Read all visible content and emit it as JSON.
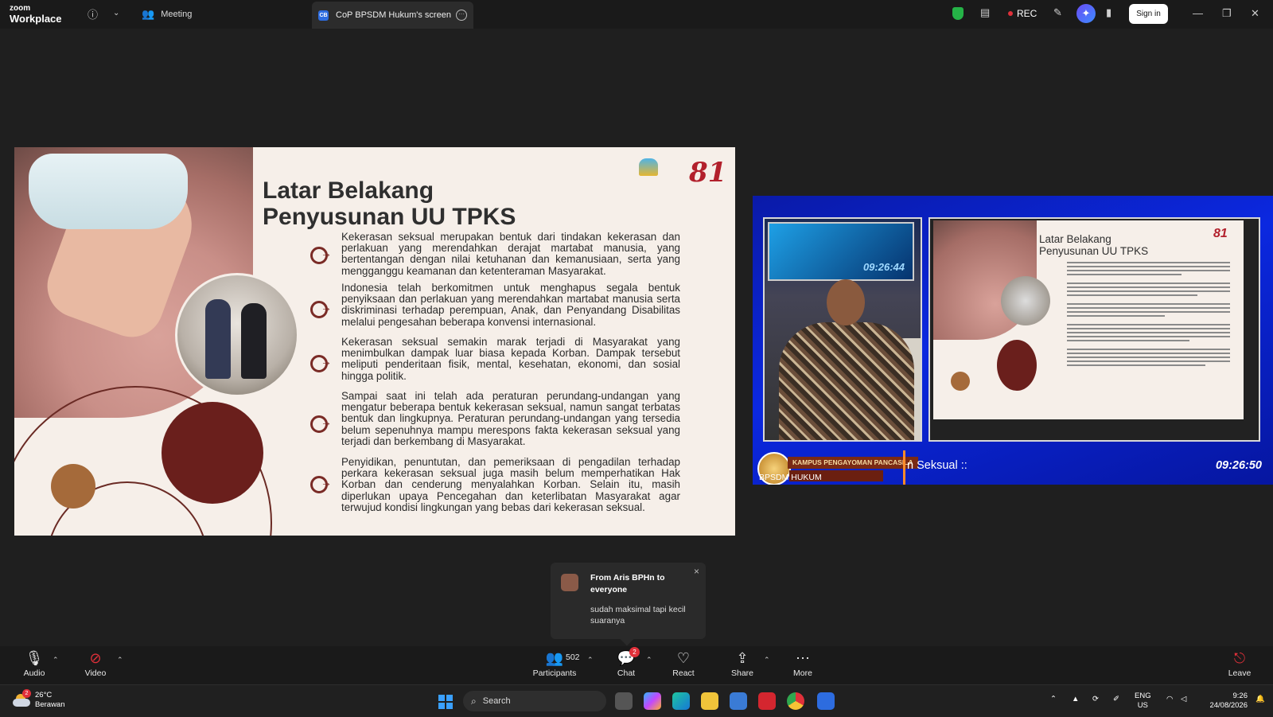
{
  "app": {
    "brand_top": "zoom",
    "brand_bottom": "Workplace"
  },
  "tabs": {
    "meeting": "Meeting",
    "screen_badge": "CB",
    "screen": "CoP BPSDM Hukum's screen"
  },
  "header": {
    "rec": "REC",
    "sign_in": "Sign in"
  },
  "slide": {
    "title_line1": "Latar Belakang",
    "title_line2": "Penyusunan UU TPKS",
    "logo_81": "81",
    "paragraphs": [
      "Kekerasan seksual merupakan bentuk dari tindakan kekerasan dan perlakuan yang merendahkan derajat martabat manusia, yang bertentangan dengan nilai ketuhanan dan kemanusiaan, serta yang mengganggu keamanan dan ketenteraman Masyarakat.",
      "Indonesia telah berkomitmen untuk menghapus segala bentuk penyiksaan dan perlakuan yang merendahkan martabat manusia serta diskriminasi terhadap perempuan, Anak, dan Penyandang Disabilitas melalui pengesahan beberapa konvensi internasional.",
      "Kekerasan seksual semakin marak terjadi di Masyarakat yang menimbulkan dampak luar biasa kepada Korban. Dampak tersebut meliputi penderitaan fisik, mental, kesehatan, ekonomi, dan sosial hingga politik.",
      "Sampai saat ini telah ada peraturan perundang-undangan yang mengatur beberapa bentuk kekerasan seksual, namun sangat terbatas bentuk dan lingkupnya. Peraturan perundang-undangan yang tersedia belum sepenuhnya mampu merespons fakta kekerasan seksual yang terjadi dan berkembang di Masyarakat.",
      "Penyidikan, penuntutan, dan pemeriksaan di pengadilan terhadap perkara kekerasan seksual juga masih belum memperhatikan Hak Korban dan cenderung menyalahkan Korban. Selain itu, masih diperlukan upaya Pencegahan dan keterlibatan Masyarakat agar terwujud kondisi lingkungan yang bebas dari kekerasan seksual."
    ]
  },
  "broadcast": {
    "studio_clock": "09:26:44",
    "program_label": "KAMPUS PENGAYOMAN PANCASILA",
    "channel": "BPSDM HUKUM",
    "ticker": "n Seksual ::",
    "time": "09:26:50"
  },
  "chat_toast": {
    "from": "From Aris BPHn to everyone",
    "message": "sudah maksimal tapi kecil suaranya",
    "close": "×"
  },
  "toolbar": {
    "audio": "Audio",
    "video": "Video",
    "participants": "Participants",
    "participants_count": "502",
    "chat": "Chat",
    "chat_badge": "2",
    "react": "React",
    "share": "Share",
    "more": "More",
    "leave": "Leave"
  },
  "taskbar": {
    "weather_badge": "2",
    "temperature": "26°C",
    "condition": "Berawan",
    "search": "Search",
    "lang_line1": "ENG",
    "lang_line2": "US",
    "time": "9:26",
    "date": "24/08/2026"
  },
  "colors": {
    "accent_red": "#e0303a",
    "slide_bg": "#f6efe9",
    "broadcast_blue": "#0b28e0",
    "dark_maroon": "#6a1f1c"
  }
}
